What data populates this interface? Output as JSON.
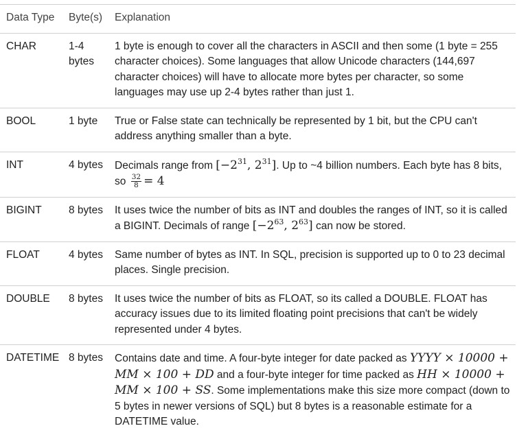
{
  "table": {
    "headers": [
      "Data Type",
      "Byte(s)",
      "Explanation"
    ],
    "rows": [
      {
        "type": "CHAR",
        "bytes": "1-4 bytes",
        "explanation": [
          "1 byte is enough to cover all the characters in ASCII and then some (1 byte = 255 character choices). Some languages that allow Unicode characters (144,697 character choices) will have to allocate more bytes per character, so some languages may use up 2-4 bytes rather than just 1."
        ]
      },
      {
        "type": "BOOL",
        "bytes": "1 byte",
        "explanation": [
          "True or False state can technically be represented by 1 bit, but the CPU can't address anything smaller than a byte."
        ]
      },
      {
        "type": "INT",
        "bytes": "4 bytes",
        "explanation": [
          "Decimals range from ",
          "[−2",
          "31",
          ", 2",
          "31",
          "]",
          ". Up to ~4 billion numbers. Each byte has 8 bits, so ",
          "32",
          "8",
          "= 4"
        ]
      },
      {
        "type": "BIGINT",
        "bytes": "8 bytes",
        "explanation": [
          "It uses twice the number of bits as INT and doubles the ranges of INT, so it is called a BIGINT. Decimals of range ",
          "[−2",
          "63",
          ", 2",
          "63",
          "]",
          " can now be stored."
        ]
      },
      {
        "type": "FLOAT",
        "bytes": "4 bytes",
        "explanation": [
          "Same number of bytes as INT. In SQL, precision is supported up to 0 to 23 decimal places. Single precision."
        ]
      },
      {
        "type": "DOUBLE",
        "bytes": "8 bytes",
        "explanation": [
          "It uses twice the number of bits as FLOAT, so its called a DOUBLE. FLOAT has accuracy issues due to its limited floating point precisions that can't be widely represented under 4 bytes."
        ]
      },
      {
        "type": "DATETIME",
        "bytes": "8 bytes",
        "explanation": [
          "Contains date and time. A four-byte integer for date packed as ",
          "YYYY × 10000 + MM × 100 + DD",
          " and a four-byte integer for time packed as ",
          "HH × 10000 + MM × 100 + SS",
          ". Some implementations make this size more compact (down to 5 bytes in newer versions of SQL) but 8 bytes is a reasonable estimate for a DATETIME value."
        ]
      }
    ]
  }
}
